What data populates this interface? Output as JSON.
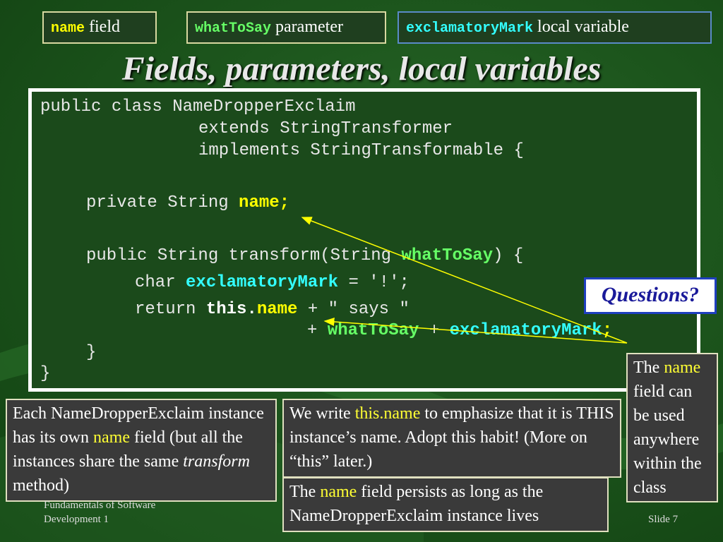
{
  "tags": {
    "name_field": {
      "code": "name",
      "label": "field"
    },
    "param": {
      "code": "whatToSay",
      "label": "parameter"
    },
    "local": {
      "code": "exclamatoryMark",
      "label": "local variable"
    }
  },
  "title": "Fields, parameters, local variables",
  "code": {
    "l1": "public class NameDropperExclaim",
    "l2": "extends StringTransformer",
    "l3": "implements StringTransformable {",
    "l4_pre": "private String ",
    "l4_name": "name;",
    "l5_pre": "public String transform(String ",
    "l5_param": "whatToSay",
    "l5_post": ") {",
    "l6_pre": "char ",
    "l6_var": "exclamatoryMark",
    "l6_post": " = '!';",
    "l7_pre": "return ",
    "l7_this": "this.",
    "l7_name": "name",
    "l7_post": " + \" says \"",
    "l8_plus": "+ ",
    "l8_param": "whatToSay",
    "l8_mid": " + ",
    "l8_var": "exclamatoryMark",
    "l8_end": ";",
    "l9": "}",
    "l10": "}"
  },
  "questions": "Questions?",
  "notes": {
    "instance": {
      "p1": "Each NameDropperExclaim instance has its own ",
      "hl": "name",
      "p2": " field (but all the instances share the same ",
      "em": "transform",
      "p3": " method)"
    },
    "this": {
      "p1": "We write ",
      "hl": "this.name",
      "p2": " to emphasize that it is THIS instance’s name.  Adopt this habit!  (More on “this” later.)"
    },
    "persist": {
      "p1": "The ",
      "hl": "name",
      "p2": " field persists as long as the NameDropperExclaim instance lives"
    },
    "anywhere": {
      "p1": "The ",
      "hl": "name",
      "p2": " field can be used anywhere within the class"
    }
  },
  "footer": {
    "left": "Fundamentals of Software Development 1",
    "right": "Slide 7"
  },
  "colors": {
    "background": "#1d561d",
    "highlight_yellow": "#ffff00",
    "param_green": "#66ff66",
    "local_cyan": "#33ffff"
  }
}
